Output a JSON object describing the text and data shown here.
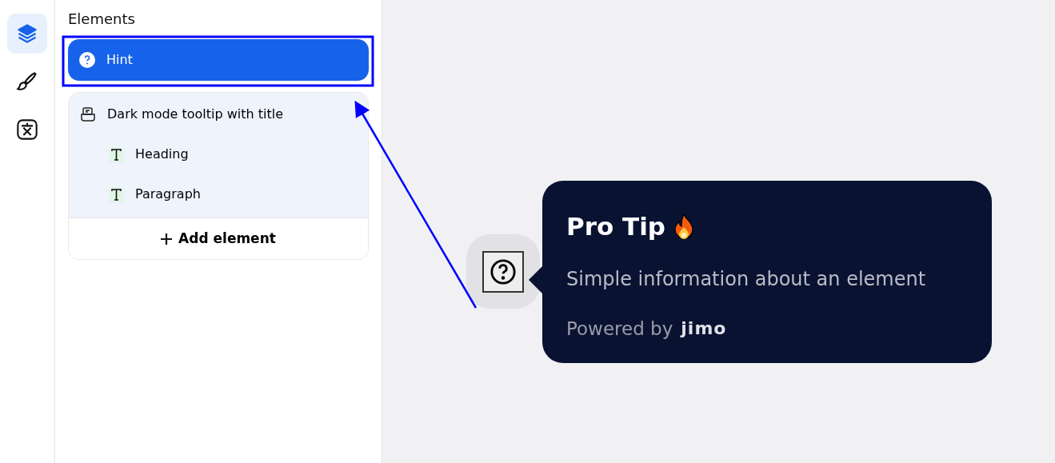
{
  "rail": [
    {
      "kind": "layers",
      "selected": true
    },
    {
      "kind": "brush",
      "selected": false
    },
    {
      "kind": "translate",
      "selected": false
    }
  ],
  "sidebar": {
    "title": "Elements",
    "items": [
      {
        "kind": "hint",
        "label": "Hint",
        "selected": true
      },
      {
        "kind": "tooltip",
        "label": "Dark mode tooltip with title",
        "selected": false,
        "children": [
          {
            "kind": "text",
            "label": "Heading"
          },
          {
            "kind": "text",
            "label": "Paragraph"
          }
        ]
      }
    ],
    "add_button": "Add element"
  },
  "tooltip": {
    "title": "Pro Tip",
    "body": "Simple information about an element",
    "footer": "Powered by",
    "brand": "jimo"
  }
}
